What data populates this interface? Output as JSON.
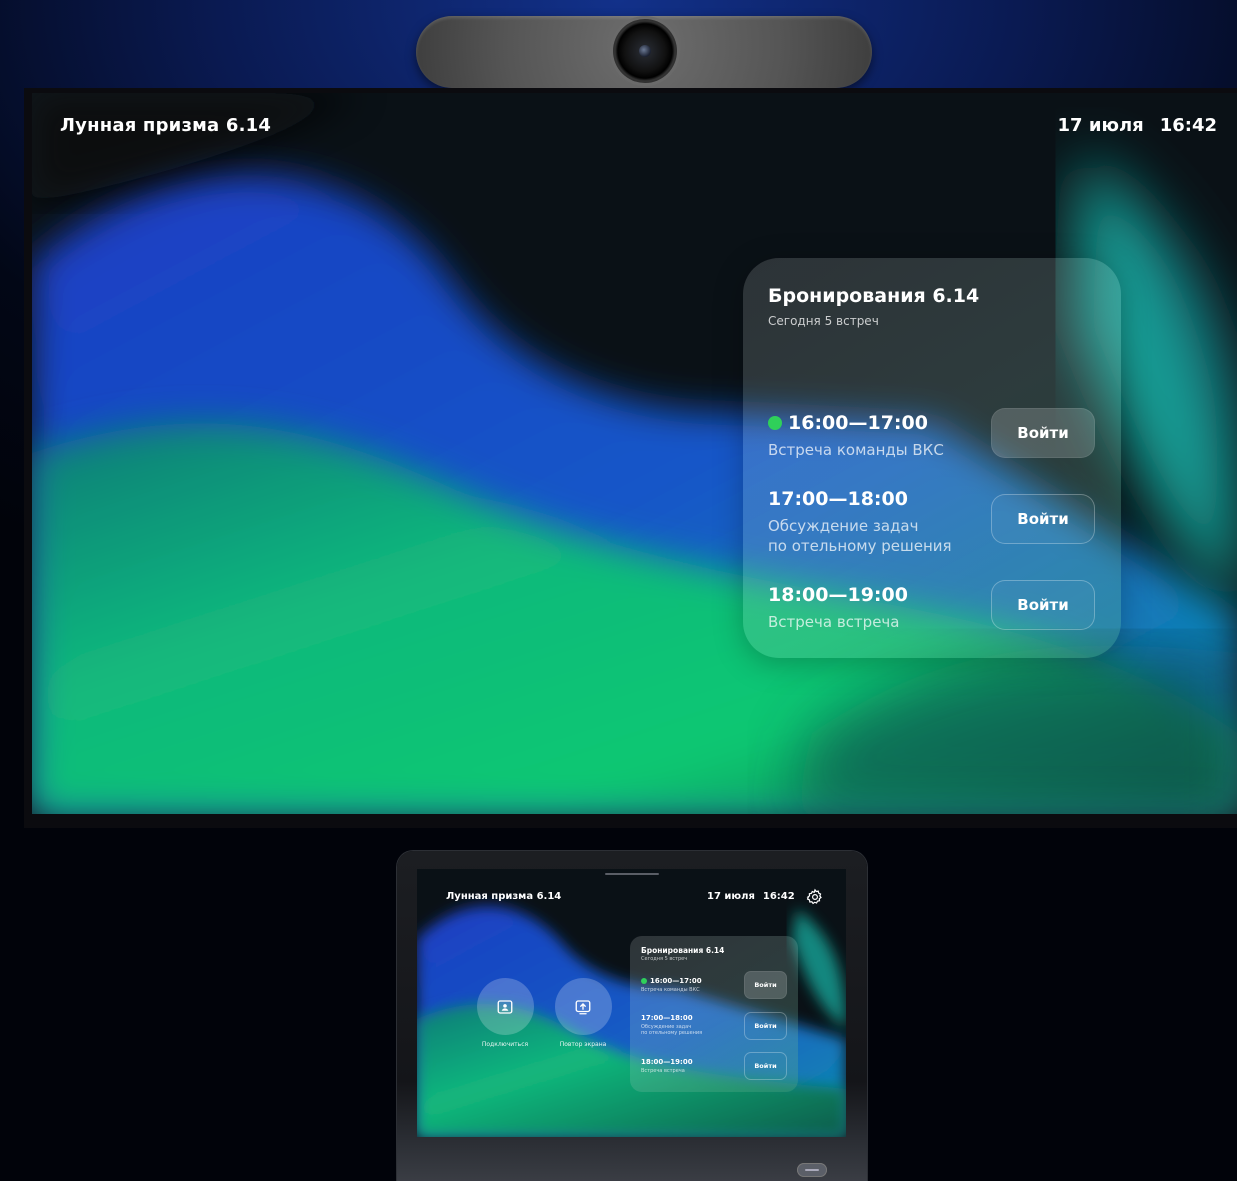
{
  "room": {
    "name": "Лунная призма 6.14",
    "date": "17 июля",
    "time": "16:42"
  },
  "bookings": {
    "title": "Бронирования 6.14",
    "subtitle": "Сегодня 5 встреч",
    "meetings": [
      {
        "time": "16:00—17:00",
        "name": "Встреча команды ВКС",
        "active": true,
        "button": "Войти"
      },
      {
        "time": "17:00—18:00",
        "name_line1": "Обсуждение задач",
        "name_line2": "по отельному решения",
        "active": false,
        "button": "Войти"
      },
      {
        "time": "18:00—19:00",
        "name": "Встреча встреча",
        "active": false,
        "button": "Войти"
      }
    ]
  },
  "tablet": {
    "actions": [
      {
        "label": "Подключиться",
        "icon": "contact-card-icon"
      },
      {
        "label": "Повтор экрана",
        "icon": "screen-share-icon"
      }
    ],
    "settings_icon": "gear-icon"
  },
  "colors": {
    "active_dot": "#2fd05a",
    "background": "#020716",
    "wallpaper_blue": "#1d4bd0",
    "wallpaper_green": "#13c07a"
  }
}
